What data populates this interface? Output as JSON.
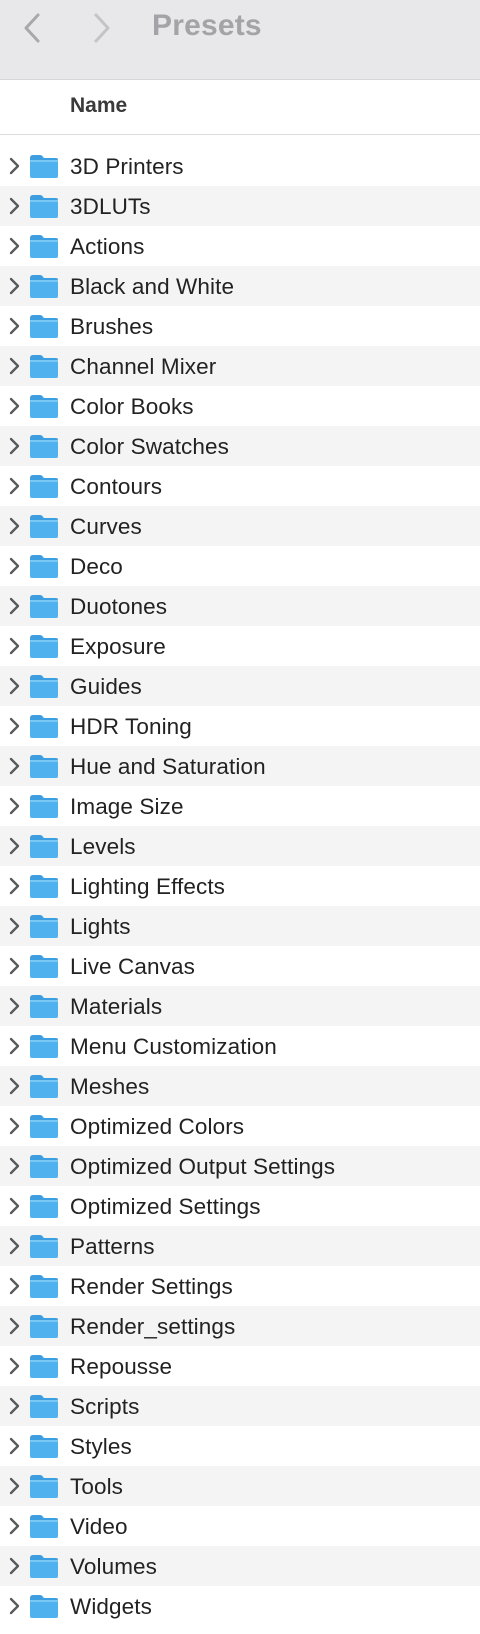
{
  "window": {
    "title": "Presets"
  },
  "toolbar": {
    "back_icon": "chevron-left-icon",
    "forward_icon": "chevron-right-icon"
  },
  "header": {
    "name_label": "Name"
  },
  "colors": {
    "folder_blue": "#4fb2ef",
    "toolbar_bg": "#e8e8ea",
    "stripe_bg": "#f4f4f5"
  },
  "items": [
    {
      "label": "3D Printers"
    },
    {
      "label": "3DLUTs"
    },
    {
      "label": "Actions"
    },
    {
      "label": "Black and White"
    },
    {
      "label": "Brushes"
    },
    {
      "label": "Channel Mixer"
    },
    {
      "label": "Color Books"
    },
    {
      "label": "Color Swatches"
    },
    {
      "label": "Contours"
    },
    {
      "label": "Curves"
    },
    {
      "label": "Deco"
    },
    {
      "label": "Duotones"
    },
    {
      "label": "Exposure"
    },
    {
      "label": "Guides"
    },
    {
      "label": "HDR Toning"
    },
    {
      "label": "Hue and Saturation"
    },
    {
      "label": "Image Size"
    },
    {
      "label": "Levels"
    },
    {
      "label": "Lighting Effects"
    },
    {
      "label": "Lights"
    },
    {
      "label": "Live Canvas"
    },
    {
      "label": "Materials"
    },
    {
      "label": "Menu Customization"
    },
    {
      "label": "Meshes"
    },
    {
      "label": "Optimized Colors"
    },
    {
      "label": "Optimized Output Settings"
    },
    {
      "label": "Optimized Settings"
    },
    {
      "label": "Patterns"
    },
    {
      "label": "Render Settings"
    },
    {
      "label": "Render_settings"
    },
    {
      "label": "Repousse"
    },
    {
      "label": "Scripts"
    },
    {
      "label": "Styles"
    },
    {
      "label": "Tools"
    },
    {
      "label": "Video"
    },
    {
      "label": "Volumes"
    },
    {
      "label": "Widgets"
    }
  ]
}
